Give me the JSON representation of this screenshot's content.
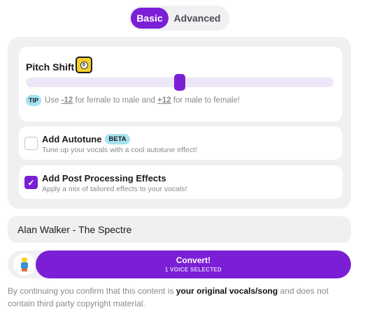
{
  "tabs": {
    "basic": "Basic",
    "advanced": "Advanced"
  },
  "pitch": {
    "title": "Pitch Shift",
    "value": "0",
    "slider_fraction": 0.5,
    "tip_badge": "TIP",
    "tip_use": "Use",
    "tip_minus": "-12",
    "tip_mid": "for female to male and",
    "tip_plus": "+12",
    "tip_end": "for male to female!"
  },
  "autotune": {
    "label": "Add Autotune",
    "badge": "BETA",
    "description": "Tune up your vocals with a cool autotune effect!",
    "checked": false
  },
  "post_processing": {
    "label": "Add Post Processing Effects",
    "description": "Apply a mix of tailored effects to your vocals!",
    "checked": true,
    "check_glyph": "✓"
  },
  "song": {
    "value": "Alan Walker - The Spectre"
  },
  "convert": {
    "label": "Convert!",
    "sub_label": "1 VOICE SELECTED",
    "accent": "#7b1fd6"
  },
  "disclaimer": {
    "before": "By continuing you confirm that this content is",
    "emphasis": "your original vocals/song",
    "after": "and does not contain third party copyright material."
  }
}
